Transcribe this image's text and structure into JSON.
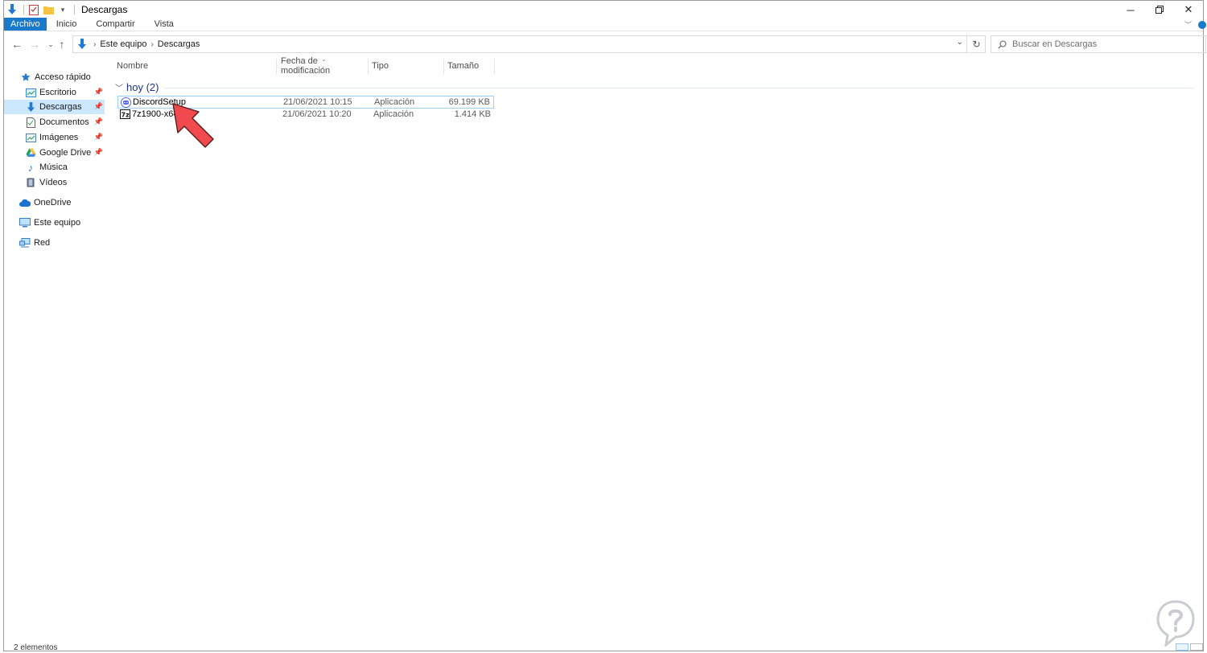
{
  "window": {
    "title": "Descargas"
  },
  "ribbon": {
    "tabs": [
      "Archivo",
      "Inicio",
      "Compartir",
      "Vista"
    ]
  },
  "address": {
    "crumbs": [
      "Este equipo",
      "Descargas"
    ]
  },
  "search": {
    "placeholder": "Buscar en Descargas"
  },
  "sidebar": {
    "quick_access": "Acceso rápido",
    "items": [
      {
        "label": "Escritorio",
        "pinned": true
      },
      {
        "label": "Descargas",
        "pinned": true,
        "selected": true
      },
      {
        "label": "Documentos",
        "pinned": true
      },
      {
        "label": "Imágenes",
        "pinned": true
      },
      {
        "label": "Google Drive",
        "pinned": true
      },
      {
        "label": "Música",
        "pinned": false
      },
      {
        "label": "Vídeos",
        "pinned": false
      }
    ],
    "onedrive": "OneDrive",
    "this_pc": "Este equipo",
    "network": "Red"
  },
  "columns": {
    "name": "Nombre",
    "date": "Fecha de modificación",
    "type": "Tipo",
    "size": "Tamaño"
  },
  "group": {
    "label": "hoy (2)"
  },
  "files": [
    {
      "name": "DiscordSetup",
      "date": "21/06/2021 10:15",
      "type": "Aplicación",
      "size": "69.199 KB",
      "icon": "discord-icon",
      "selected": true
    },
    {
      "name": "7z1900-x64",
      "date": "21/06/2021 10:20",
      "type": "Aplicación",
      "size": "1.414 KB",
      "icon": "7zip-icon",
      "selected": false
    }
  ],
  "status": {
    "count": "2 elementos"
  },
  "colors": {
    "accent": "#1979ca",
    "selected_bg": "#cce8ff",
    "arrow": "#f04a4f"
  }
}
